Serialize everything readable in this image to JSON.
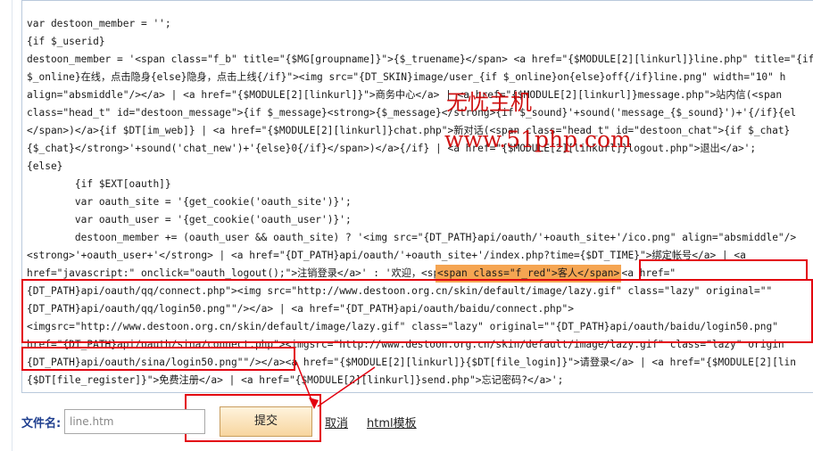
{
  "code_lines": [
    "var destoon_member = '';",
    "{if $_userid}",
    "destoon_member = '<span class=\"f_b\" title=\"{$MG[groupname]}\">{$_truename}</span> <a href=\"{$MODULE[2][linkurl]}line.php\" title=\"{if",
    "$_online}在线，点击隐身{else}隐身，点击上线{/if}\"><img src=\"{DT_SKIN}image/user_{if $_online}on{else}off{/if}line.png\" width=\"10\" h",
    "align=\"absmiddle\"/></a> | <a href=\"{$MODULE[2][linkurl]}\">商务中心</a> | <a href=\"{$MODULE[2][linkurl]}message.php\">站内信(<span",
    "class=\"head_t\" id=\"destoon_message\">{if $_message}<strong>{$_message}</strong>{if $_sound}'+sound('message_{$_sound}')+'{/if}{el",
    "</span>)</a>{if $DT[im_web]} | <a href=\"{$MODULE[2][linkurl]}chat.php\">新对话(<span class=\"head_t\" id=\"destoon_chat\">{if $_chat}",
    "{$_chat}</strong>'+sound('chat_new')+'{else}0{/if}</span>)</a>{/if} | <a href=\"{$MODULE[2][linkurl]}logout.php\">退出</a>';",
    "{else}",
    "        {if $EXT[oauth]}",
    "        var oauth_site = '{get_cookie('oauth_site')}';",
    "        var oauth_user = '{get_cookie('oauth_user')}';",
    "        destoon_member += (oauth_user && oauth_site) ? '<img src=\"{DT_PATH}api/oauth/'+oauth_site+'/ico.png\" align=\"absmiddle\"/>",
    "<strong>'+oauth_user+'</strong> | <a href=\"{DT_PATH}api/oauth/'+oauth_site+'/index.php?time={$DT_TIME}\">绑定帐号</a> | <a",
    "href=\"javascript:\" onclick=\"oauth_logout();\">注销登录</a>' : '欢迎，<span class=\"f_red\">客人</span> | <a href=\"",
    "{DT_PATH}api/oauth/qq/connect.php\"><img src=\"http://www.destoon.org.cn/skin/default/image/lazy.gif\" class=\"lazy\" original=\"\"",
    "{DT_PATH}api/oauth/qq/login50.png\"\"/></a> | <a href=\"{DT_PATH}api/oauth/baidu/connect.php\">",
    "<imgsrc=\"http://www.destoon.org.cn/skin/default/image/lazy.gif\" class=\"lazy\" original=\"\"{DT_PATH}api/oauth/baidu/login50.png\"",
    "href=\"{DT_PATH}api/oauth/sina/connect.php\"><imgsrc=\"http://www.destoon.org.cn/skin/default/image/lazy.gif\" class=\"lazy\" origin",
    "{DT_PATH}api/oauth/sina/login50.png\"\"/></a><a href=\"{$MODULE[2][linkurl]}{$DT[file_login]}\">请登录</a> | <a href=\"{$MODULE[2][lin",
    "{$DT[file_register]}\">免费注册</a> | <a href=\"{$MODULE[2][linkurl]}send.php\">忘记密码?</a>';"
  ],
  "highlight_text": "<span class=\"f_red\">客人</span>",
  "watermark": {
    "line1": "无忧主机",
    "line2": "www.51php.com"
  },
  "footer": {
    "filename_label": "文件名:",
    "filename_value": "line.htm",
    "submit_label": "提交",
    "cancel_label": "取消",
    "template_link": "html模板"
  },
  "colors": {
    "annotation_red": "#e3000f",
    "highlight_orange": "#f5a552",
    "label_blue": "#1f3f8f"
  }
}
